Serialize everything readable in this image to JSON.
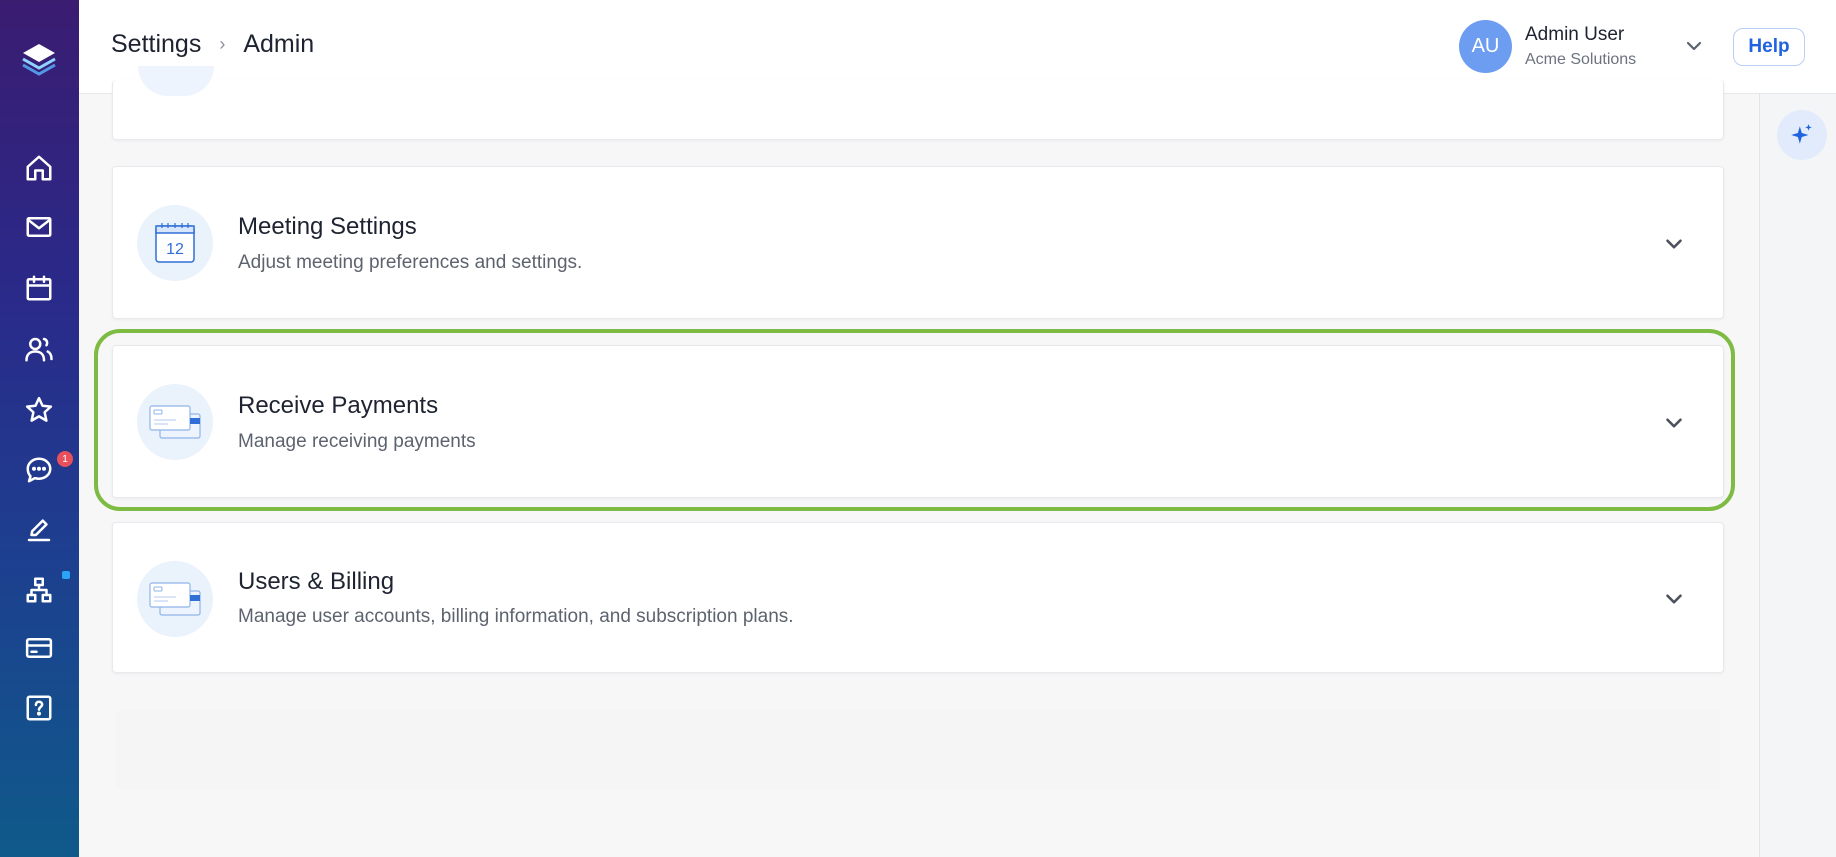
{
  "header": {
    "breadcrumb": [
      "Settings",
      "Admin"
    ],
    "breadcrumb_separator": "›",
    "user": {
      "initials": "AU",
      "name": "Admin User",
      "org": "Acme Solutions"
    },
    "help_label": "Help"
  },
  "sidebar": {
    "items": [
      {
        "icon": "home-icon"
      },
      {
        "icon": "mail-icon"
      },
      {
        "icon": "calendar-icon"
      },
      {
        "icon": "users-icon"
      },
      {
        "icon": "star-icon"
      },
      {
        "icon": "chat-icon",
        "badge": "1"
      },
      {
        "icon": "edit-icon"
      },
      {
        "icon": "org-chart-icon"
      },
      {
        "icon": "credit-card-icon"
      },
      {
        "icon": "help-box-icon"
      }
    ]
  },
  "cards": [
    {
      "title": "Meeting Settings",
      "description": "Adjust meeting preferences and settings.",
      "icon": "calendar-12-icon",
      "icon_text": "12"
    },
    {
      "title": "Receive Payments",
      "description": "Manage receiving payments",
      "icon": "payment-cards-icon",
      "highlighted": true
    },
    {
      "title": "Users & Billing",
      "description": "Manage user accounts, billing information, and subscription plans.",
      "icon": "billing-cards-icon"
    }
  ],
  "colors": {
    "highlight": "#7dbb42",
    "accent": "#1f63e0",
    "avatar": "#6d9df1",
    "badge_red": "#e8505b",
    "badge_blue": "#2aa4f4"
  }
}
